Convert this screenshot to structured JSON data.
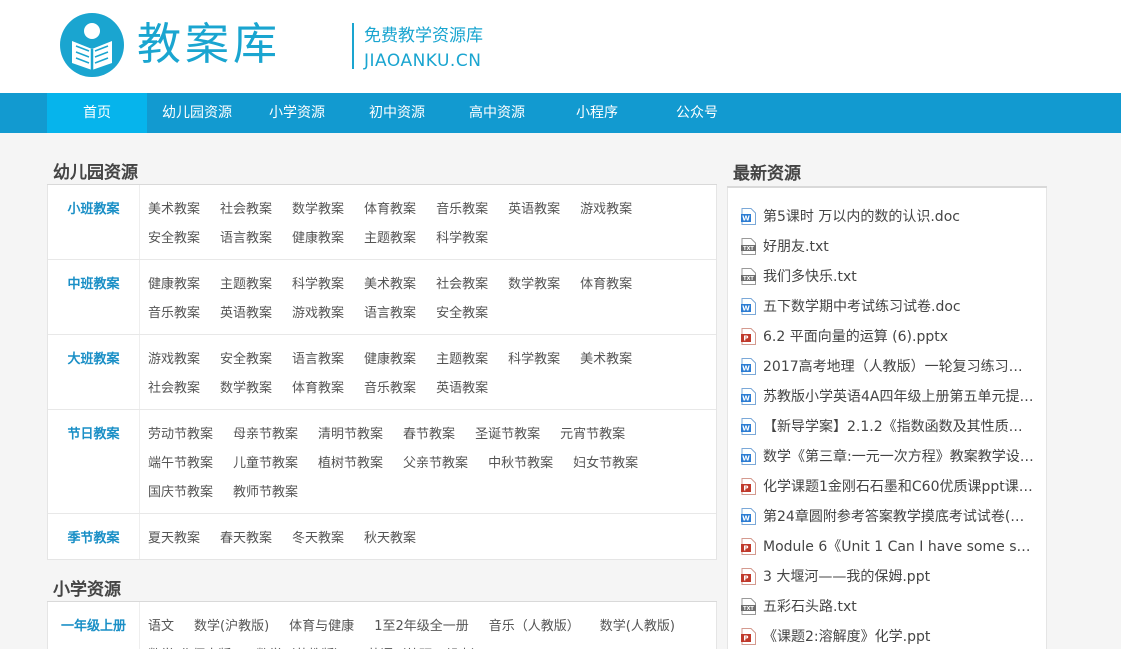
{
  "site": {
    "name": "教案库",
    "slogan": "免费教学资源库",
    "domain": "JIAOANKU.CN"
  },
  "nav": [
    "首页",
    "幼儿园资源",
    "小学资源",
    "初中资源",
    "高中资源",
    "小程序",
    "公众号"
  ],
  "sections": [
    {
      "title": "幼儿园资源",
      "rows": [
        {
          "name": "小班教案",
          "links": [
            "美术教案",
            "社会教案",
            "数学教案",
            "体育教案",
            "音乐教案",
            "英语教案",
            "游戏教案",
            "安全教案",
            "语言教案",
            "健康教案",
            "主题教案",
            "科学教案"
          ]
        },
        {
          "name": "中班教案",
          "links": [
            "健康教案",
            "主题教案",
            "科学教案",
            "美术教案",
            "社会教案",
            "数学教案",
            "体育教案",
            "音乐教案",
            "英语教案",
            "游戏教案",
            "语言教案",
            "安全教案"
          ]
        },
        {
          "name": "大班教案",
          "links": [
            "游戏教案",
            "安全教案",
            "语言教案",
            "健康教案",
            "主题教案",
            "科学教案",
            "美术教案",
            "社会教案",
            "数学教案",
            "体育教案",
            "音乐教案",
            "英语教案"
          ]
        },
        {
          "name": "节日教案",
          "links": [
            "劳动节教案",
            "母亲节教案",
            "清明节教案",
            "春节教案",
            "圣诞节教案",
            "元宵节教案",
            "端午节教案",
            "儿童节教案",
            "植树节教案",
            "父亲节教案",
            "中秋节教案",
            "妇女节教案",
            "国庆节教案",
            "教师节教案"
          ]
        },
        {
          "name": "季节教案",
          "links": [
            "夏天教案",
            "春天教案",
            "冬天教案",
            "秋天教案"
          ]
        }
      ]
    },
    {
      "title": "小学资源",
      "rows": [
        {
          "name": "一年级上册",
          "links": [
            "语文",
            "数学(沪教版)",
            "体育与健康",
            "1至2年级全一册",
            "音乐（人教版）",
            "数学(人教版)",
            "数学(北师大版)",
            "数学（苏教版）",
            "英语（外研一起点）"
          ]
        }
      ]
    }
  ],
  "latest": {
    "title": "最新资源",
    "items": [
      {
        "type": "doc",
        "title": "第5课时 万以内的数的认识.doc"
      },
      {
        "type": "txt",
        "title": "好朋友.txt"
      },
      {
        "type": "txt",
        "title": "我们多快乐.txt"
      },
      {
        "type": "doc",
        "title": "五下数学期中考试练习试卷.doc"
      },
      {
        "type": "ppt",
        "title": "6.2 平面向量的运算 (6).pptx"
      },
      {
        "type": "doc",
        "title": "2017高考地理（人教版）一轮复习练习：…"
      },
      {
        "type": "doc",
        "title": "苏教版小学英语4A四年级上册第五单元提…"
      },
      {
        "type": "doc",
        "title": "【新导学案】2.1.2《指数函数及其性质（…"
      },
      {
        "type": "doc",
        "title": "数学《第三章:一元一次方程》教案教学设…"
      },
      {
        "type": "ppt",
        "title": "化学课题1金刚石石墨和C60优质课ppt课…"
      },
      {
        "type": "doc",
        "title": "第24章圆附参考答案教学摸底考试试卷(数…"
      },
      {
        "type": "ppt",
        "title": "Module 6《Unit 1 Can I have some sw…"
      },
      {
        "type": "ppt",
        "title": "3 大堰河——我的保姆.ppt"
      },
      {
        "type": "txt",
        "title": "五彩石头路.txt"
      },
      {
        "type": "ppt",
        "title": "《课题2:溶解度》化学.ppt"
      }
    ]
  },
  "icon_names": {
    "doc": "word-doc-icon",
    "txt": "txt-file-icon",
    "ppt": "ppt-file-icon"
  },
  "colors": {
    "brand": "#1aa5d0",
    "nav_bg": "#129ad0",
    "nav_active": "#06b4ec",
    "category_text": "#1a8fc6",
    "doc_icon": "#2b7cd3",
    "ppt_icon": "#c0392b",
    "txt_icon": "#7a7a7a"
  }
}
